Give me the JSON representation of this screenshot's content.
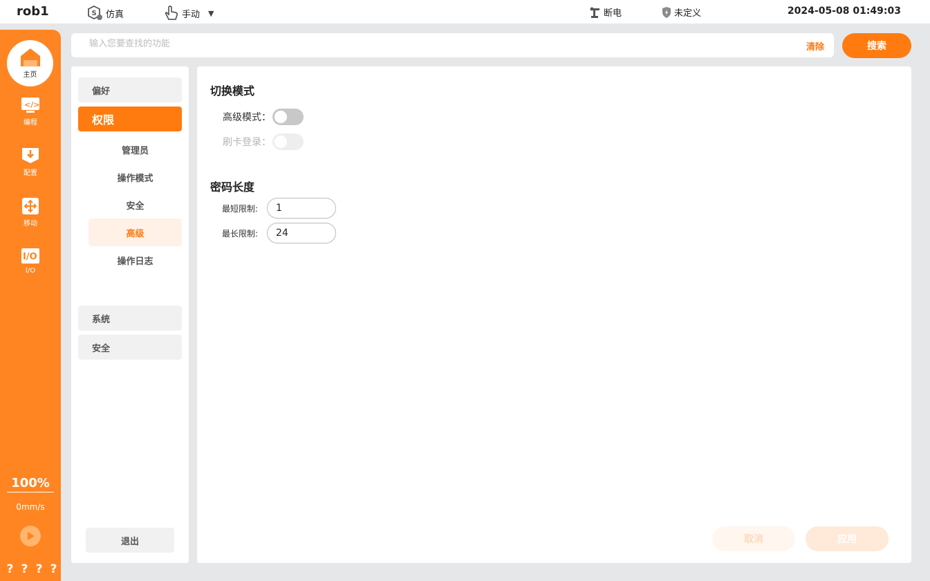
{
  "topbar": {
    "robot_name": "rob1",
    "sim_label": "仿真",
    "mode_label": "手动",
    "power_label": "断电",
    "safety_label": "未定义",
    "datetime": "2024-05-08 01:49:03"
  },
  "rail": {
    "home_label": "主页",
    "items": [
      {
        "label": "编程",
        "icon": "code-icon"
      },
      {
        "label": "配置",
        "icon": "config-icon"
      },
      {
        "label": "移动",
        "icon": "move-icon"
      },
      {
        "label": "I/O",
        "icon": "io-icon"
      }
    ],
    "speed_percent": "100%",
    "speed_mm": "0mm/s",
    "question_marks": [
      "?",
      "?",
      "?",
      "?"
    ]
  },
  "search": {
    "placeholder": "输入您要查找的功能",
    "value": "",
    "clear_label": "清除",
    "button_label": "搜索"
  },
  "menu": {
    "groups": [
      "偏好",
      "权限",
      "系统",
      "安全"
    ],
    "active_group": "权限",
    "sub_items": [
      "管理员",
      "操作模式",
      "安全",
      "高级",
      "操作日志"
    ],
    "active_sub_item": "高级",
    "logout_label": "退出"
  },
  "main": {
    "switch_mode": {
      "title": "切换模式",
      "advanced_mode_label": "高级模式：",
      "advanced_mode_on": false,
      "card_login_label": "刷卡登录：",
      "card_login_on": false,
      "card_login_disabled": true
    },
    "password_length": {
      "title": "密码长度",
      "min_label": "最短限制:",
      "min_value": "1",
      "max_label": "最长限制:",
      "max_value": "24"
    },
    "cancel_label": "取消",
    "apply_label": "应用"
  },
  "colors": {
    "accent": "#ff7b0f",
    "rail": "#ff8522",
    "background": "#e6e7e9"
  }
}
